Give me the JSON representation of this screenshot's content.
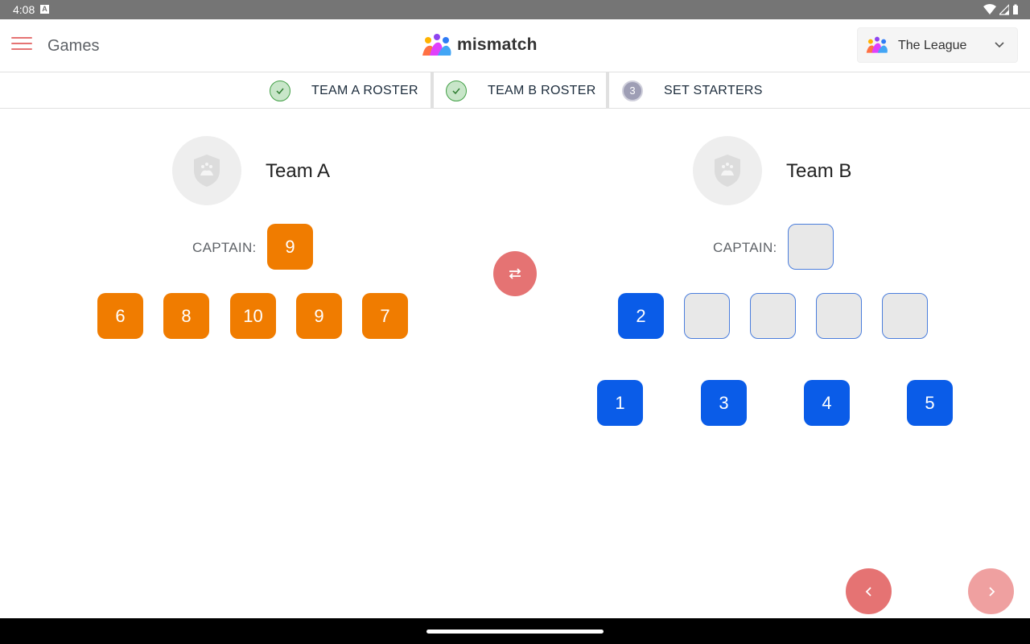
{
  "status_bar": {
    "time": "4:08",
    "notification_badge": "A"
  },
  "app_bar": {
    "title": "Games",
    "logo_text": "mismatch",
    "league_selector": {
      "value": "The League"
    }
  },
  "stepper": {
    "steps": [
      {
        "label": "TEAM A ROSTER",
        "state": "complete"
      },
      {
        "label": "TEAM B ROSTER",
        "state": "complete"
      },
      {
        "label": "SET STARTERS",
        "state": "current",
        "number": "3"
      }
    ]
  },
  "team_a": {
    "name": "Team A",
    "captain_label": "CAPTAIN:",
    "captain": "9",
    "starters": [
      "6",
      "8",
      "10",
      "9",
      "7"
    ]
  },
  "team_b": {
    "name": "Team B",
    "captain_label": "CAPTAIN:",
    "captain": "",
    "starters": [
      "2",
      "",
      "",
      "",
      ""
    ],
    "bench": [
      "1",
      "3",
      "4",
      "5"
    ]
  },
  "colors": {
    "team_a_tile": "#f07c00",
    "team_b_tile": "#0a5ce8",
    "accent": "#e57373"
  },
  "icons": {
    "menu": "hamburger-icon",
    "swap": "swap-horizontal-icon",
    "prev": "chevron-left-icon",
    "next": "chevron-right-icon",
    "dropdown": "chevron-down-icon"
  }
}
